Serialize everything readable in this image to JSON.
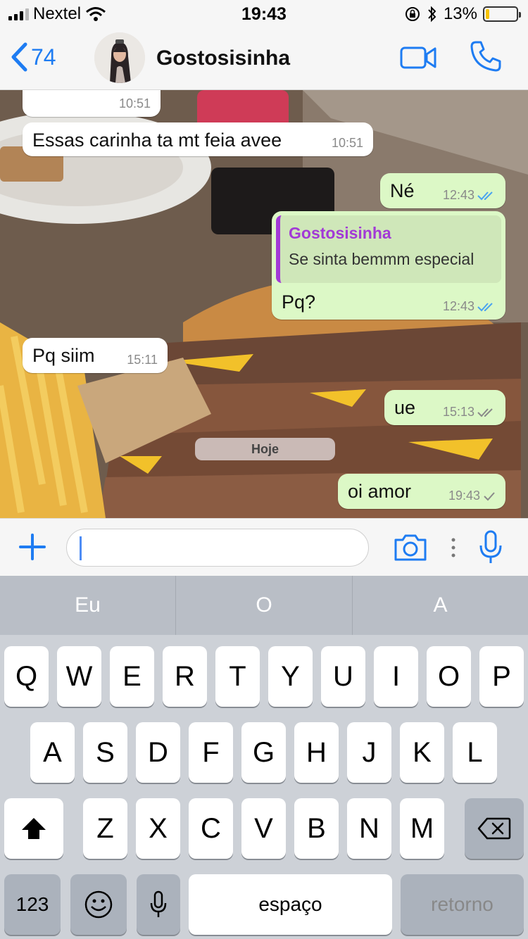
{
  "status_bar": {
    "carrier": "Nextel",
    "time": "19:43",
    "battery_percent": "13%",
    "battery_level": 0.13
  },
  "header": {
    "back_count": "74",
    "contact_name": "Gostosisinha"
  },
  "messages": [
    {
      "direction": "in",
      "text": "",
      "time": "10:51"
    },
    {
      "direction": "in",
      "text": "Essas carinha ta mt feia avee",
      "time": "10:51"
    },
    {
      "direction": "out",
      "text": "Né",
      "time": "12:43",
      "status": "read"
    },
    {
      "direction": "out",
      "quote_author": "Gostosisinha",
      "quote_text": "Se sinta bemmm especial",
      "text": "Pq?",
      "time": "12:43",
      "status": "read"
    },
    {
      "direction": "in",
      "text": "Pq siim",
      "time": "15:11"
    },
    {
      "direction": "out",
      "text": "ue",
      "time": "15:13",
      "status": "delivered"
    },
    {
      "direction": "out",
      "text": "oi amor",
      "time": "19:43",
      "status": "sent"
    }
  ],
  "date_separator": "Hoje",
  "input": {
    "value": "",
    "placeholder": ""
  },
  "keyboard": {
    "suggestions": [
      "Eu",
      "O",
      "A"
    ],
    "row1": [
      "Q",
      "W",
      "E",
      "R",
      "T",
      "Y",
      "U",
      "I",
      "O",
      "P"
    ],
    "row2": [
      "A",
      "S",
      "D",
      "F",
      "G",
      "H",
      "J",
      "K",
      "L"
    ],
    "row3": [
      "Z",
      "X",
      "C",
      "V",
      "B",
      "N",
      "M"
    ],
    "numbers_key": "123",
    "space_key": "espaço",
    "return_key": "retorno"
  },
  "colors": {
    "accent": "#1e7cf2",
    "outgoing_bubble": "#dcf8c6",
    "incoming_bubble": "#ffffff",
    "quote_author": "#a23ad6",
    "read_ticks": "#4aa3f0"
  }
}
